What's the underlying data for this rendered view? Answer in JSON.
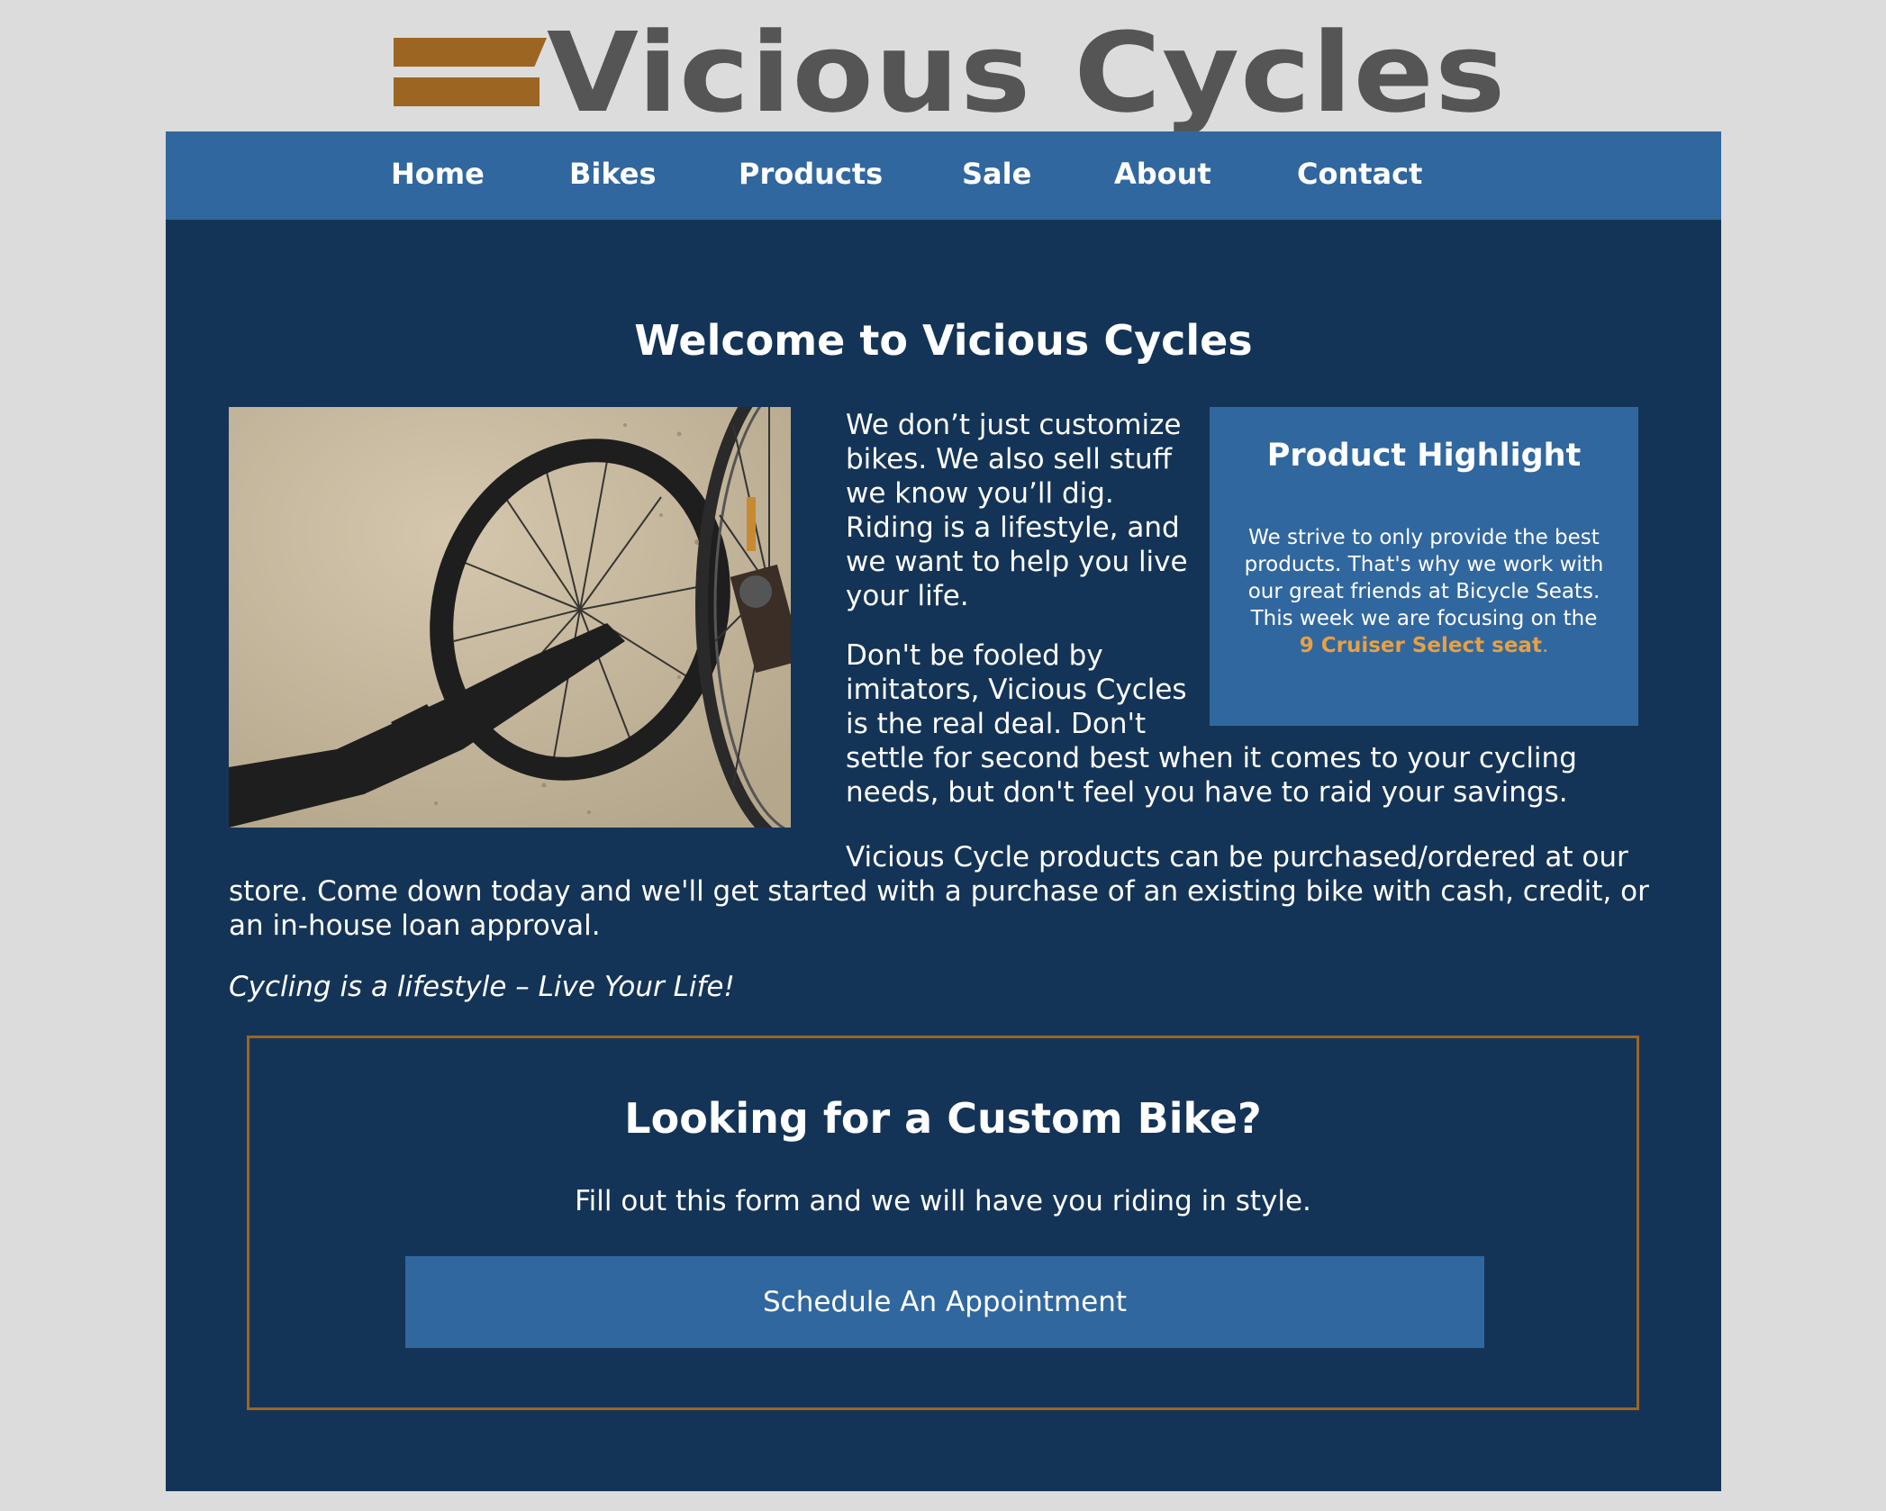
{
  "logo": {
    "text": "Vicious Cycles",
    "bar_color": "#9c6522",
    "text_color": "#555555"
  },
  "nav": {
    "items": [
      "Home",
      "Bikes",
      "Products",
      "Sale",
      "About",
      "Contact"
    ],
    "background": "#31679f"
  },
  "main": {
    "title": "Welcome to Vicious Cycles",
    "hero_image_alt": "bicycle shadow on sand",
    "paragraph1": "We don’t just customize bikes. We also sell stuff we know you’ll dig. Riding is a lifestyle, and we want to help you live your life.",
    "paragraph2_start": "Don't be fooled by imitators, Vicious Cycles is the real deal. Don't",
    "paragraph2_end": "settle for second best when it comes to your cycling needs, but don't feel you have to raid your savings.",
    "paragraph3_start": "Vicious Cycle products can be purchased/ordered at our",
    "paragraph3_end": "store. Come down today and we'll get started with a purchase of an existing bike with cash, credit, or an in-house loan approval.",
    "tagline": "Cycling is a lifestyle – Live Your Life!",
    "background": "#143457"
  },
  "highlight": {
    "title": "Product Highlight",
    "body": "We strive to only provide the best products. That's why we work with our great friends at Bicycle Seats. This week we are focusing on the",
    "link": "9 Cruiser Select seat",
    "link_suffix": ".",
    "link_color": "#e8a040"
  },
  "cta": {
    "title": "Looking for a Custom Bike?",
    "subtitle": "Fill out this form and we will have you riding in style.",
    "button": "Schedule An Appointment",
    "border_color": "#9c6522"
  }
}
